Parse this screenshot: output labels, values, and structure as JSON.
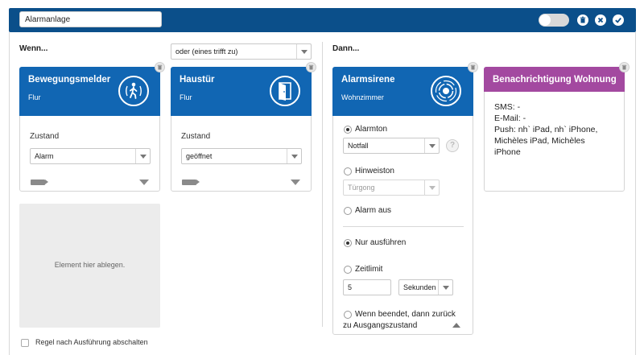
{
  "rule_name": "Alarmanlage",
  "toolbar": {
    "enabled": false
  },
  "sections": {
    "if_label": "Wenn...",
    "then_label": "Dann..."
  },
  "condition_mode": {
    "selected": "oder (eines trifft zu)"
  },
  "triggers": [
    {
      "title": "Bewegungsmelder",
      "room": "Flur",
      "state_label": "Zustand",
      "state_value": "Alarm",
      "icon": "motion-person-icon"
    },
    {
      "title": "Haustür",
      "room": "Flur",
      "state_label": "Zustand",
      "state_value": "geöffnet",
      "icon": "door-icon"
    }
  ],
  "dropzone": {
    "text": "Element hier ablegen."
  },
  "siren": {
    "title": "Alarmsirene",
    "room": "Wohnzimmer",
    "icon": "siren-icon",
    "options": {
      "alarmton": {
        "label": "Alarmton",
        "value": "Notfall",
        "checked": true
      },
      "hinweiston": {
        "label": "Hinweiston",
        "value": "Türgong",
        "checked": false
      },
      "alarm_aus": {
        "label": "Alarm aus",
        "checked": false
      }
    },
    "mode": {
      "nur_ausfuehren": {
        "label": "Nur ausführen",
        "checked": true
      },
      "zeitlimit": {
        "label": "Zeitlimit",
        "checked": false,
        "value": "5",
        "unit": "Sekunden"
      },
      "wenn_beendet": {
        "label_line1": "Wenn beendet, dann zurück",
        "label_line2": "zu Ausgangszustand",
        "checked": false
      }
    }
  },
  "notification": {
    "title": "Benachrichtigung Wohnung",
    "lines": [
      "SMS: -",
      "E-Mail: -",
      "Push: nh` iPad, nh` iPhone,",
      "Michèles iPad, Michèles",
      "iPhone"
    ]
  },
  "footer": {
    "disable_after_run_label": "Regel nach Ausführung abschalten",
    "checked": false
  },
  "colors": {
    "header_bar": "#0b4f8a",
    "card_blue": "#1166b3",
    "card_purple": "#a349a0"
  }
}
